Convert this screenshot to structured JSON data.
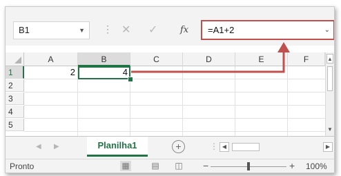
{
  "formula_bar": {
    "name_box": "B1",
    "fx_label": "fx",
    "formula": "=A1+2"
  },
  "columns": [
    "A",
    "B",
    "C",
    "D",
    "E",
    "F"
  ],
  "rows": [
    "1",
    "2",
    "3",
    "4",
    "5"
  ],
  "cells": {
    "A1": "2",
    "B1": "4"
  },
  "selected_cell": "B1",
  "sheet_tabs": {
    "active": "Planilha1"
  },
  "status_bar": {
    "text": "Pronto",
    "zoom": "100%"
  },
  "colors": {
    "accent": "#217346",
    "annotation": "#c0504d"
  },
  "icons": [
    "dropdown-icon",
    "cancel-icon",
    "enter-icon",
    "function-icon",
    "add-sheet-icon",
    "normal-view-icon",
    "page-layout-icon",
    "page-break-icon"
  ]
}
